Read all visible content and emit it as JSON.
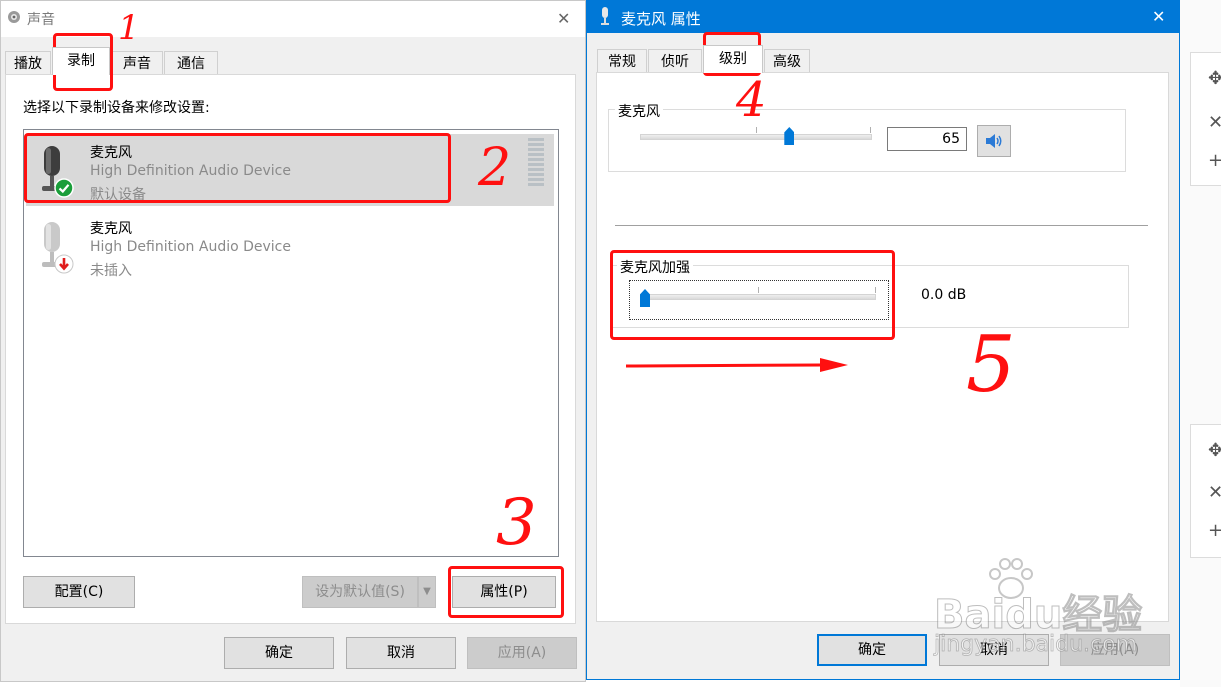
{
  "sound_dialog": {
    "title": "声音",
    "close_glyph": "✕",
    "tabs": [
      {
        "label": "播放"
      },
      {
        "label": "录制"
      },
      {
        "label": "声音"
      },
      {
        "label": "通信"
      }
    ],
    "active_tab": "录制",
    "instruction": "选择以下录制设备来修改设置:",
    "devices": [
      {
        "name": "麦克风",
        "driver": "High Definition Audio Device",
        "status": "默认设备",
        "selected": true
      },
      {
        "name": "麦克风",
        "driver": "High Definition Audio Device",
        "status": "未插入",
        "selected": false
      }
    ],
    "buttons": {
      "configure": "配置(C)",
      "set_default": "设为默认值(S)",
      "properties": "属性(P)",
      "ok": "确定",
      "cancel": "取消",
      "apply": "应用(A)"
    }
  },
  "props_dialog": {
    "title": "麦克风 属性",
    "close_glyph": "✕",
    "tabs": [
      {
        "label": "常规"
      },
      {
        "label": "侦听"
      },
      {
        "label": "级别"
      },
      {
        "label": "高级"
      }
    ],
    "active_tab": "级别",
    "microphone": {
      "label": "麦克风",
      "value": "65",
      "level": 0.65
    },
    "boost": {
      "label": "麦克风加强",
      "value": "0.0 dB",
      "level": 0.0
    },
    "buttons": {
      "ok": "确定",
      "cancel": "取消",
      "apply": "应用(A)"
    }
  },
  "annotations": [
    "1",
    "2",
    "3",
    "4",
    "5"
  ],
  "background_glyphs": {
    "move": "✥",
    "close": "✕",
    "plus": "+"
  },
  "watermark": {
    "brand": "Baidu经验",
    "url": "jingyan.baidu.com"
  },
  "colors": {
    "accent": "#0078d7",
    "annotation": "#ff1010",
    "selection": "#d9d9d9",
    "ok_badge": "#1a9e3a",
    "unplugged_badge": "#e01c1c"
  }
}
